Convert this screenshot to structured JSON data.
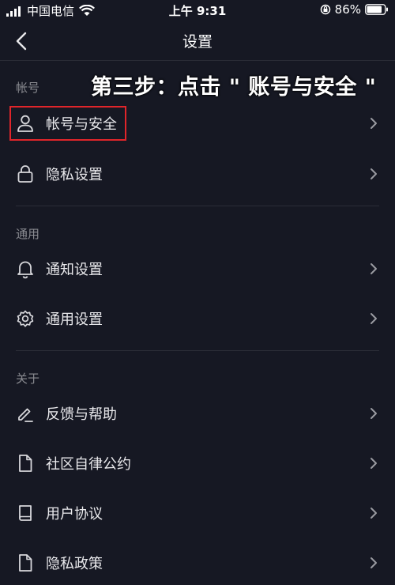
{
  "status_bar": {
    "carrier": "中国电信",
    "time": "上午 9:31",
    "battery": "86%"
  },
  "header": {
    "title": "设置"
  },
  "overlay": {
    "text": "第三步：点击 \" 账号与安全 \""
  },
  "sections": [
    {
      "title": "帐号",
      "items": [
        {
          "label": "帐号与安全",
          "icon": "user-icon"
        },
        {
          "label": "隐私设置",
          "icon": "lock-icon"
        }
      ]
    },
    {
      "title": "通用",
      "items": [
        {
          "label": "通知设置",
          "icon": "bell-icon"
        },
        {
          "label": "通用设置",
          "icon": "gear-icon"
        }
      ]
    },
    {
      "title": "关于",
      "items": [
        {
          "label": "反馈与帮助",
          "icon": "pencil-icon"
        },
        {
          "label": "社区自律公约",
          "icon": "document-icon"
        },
        {
          "label": "用户协议",
          "icon": "book-icon"
        },
        {
          "label": "隐私政策",
          "icon": "document-icon"
        }
      ]
    }
  ],
  "colors": {
    "background": "#161823",
    "highlight_border": "#e0252a",
    "section_title": "#8a8b91"
  }
}
